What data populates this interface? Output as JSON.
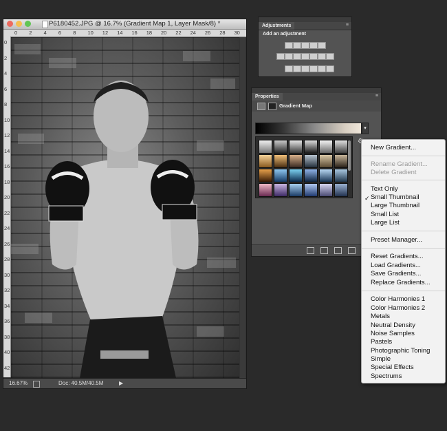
{
  "document": {
    "title": "P6180452.JPG @ 16.7% (Gradient Map 1, Layer Mask/8) *",
    "ruler_h": [
      "0",
      "2",
      "4",
      "6",
      "8",
      "10",
      "12",
      "14",
      "16",
      "18",
      "20",
      "22",
      "24",
      "26",
      "28",
      "30"
    ],
    "ruler_v": [
      "0",
      "2",
      "4",
      "6",
      "8",
      "10",
      "12",
      "14",
      "16",
      "18",
      "20",
      "22",
      "24",
      "26",
      "28",
      "30",
      "32",
      "34",
      "36",
      "38",
      "40",
      "42"
    ],
    "zoom": "16.67%",
    "doc_size": "Doc: 40.5M/40.5M",
    "status_arrow": "▶",
    "file_icon": "document-icon"
  },
  "adjustments": {
    "tab": "Adjustments",
    "subtitle": "Add an adjustment",
    "menu_glyph": "≡"
  },
  "properties": {
    "tab": "Properties",
    "title": "Gradient Map",
    "menu_glyph": "≡",
    "dropdown_glyph": "▾",
    "gear_glyph": "⚙"
  },
  "menu": {
    "items": [
      {
        "label": "New Gradient...",
        "disabled": false
      },
      {
        "label": "Rename Gradient...",
        "disabled": true
      },
      {
        "label": "Delete Gradient",
        "disabled": true
      },
      {
        "label": "Text Only",
        "disabled": false
      },
      {
        "label": "Small Thumbnail",
        "disabled": false,
        "checked": true
      },
      {
        "label": "Large Thumbnail",
        "disabled": false
      },
      {
        "label": "Small List",
        "disabled": false
      },
      {
        "label": "Large List",
        "disabled": false
      },
      {
        "label": "Preset Manager...",
        "disabled": false
      },
      {
        "label": "Reset Gradients...",
        "disabled": false
      },
      {
        "label": "Load Gradients...",
        "disabled": false
      },
      {
        "label": "Save Gradients...",
        "disabled": false
      },
      {
        "label": "Replace Gradients...",
        "disabled": false
      },
      {
        "label": "Color Harmonies 1",
        "disabled": false
      },
      {
        "label": "Color Harmonies 2",
        "disabled": false
      },
      {
        "label": "Metals",
        "disabled": false
      },
      {
        "label": "Neutral Density",
        "disabled": false
      },
      {
        "label": "Noise Samples",
        "disabled": false
      },
      {
        "label": "Pastels",
        "disabled": false
      },
      {
        "label": "Photographic Toning",
        "disabled": false
      },
      {
        "label": "Simple",
        "disabled": false
      },
      {
        "label": "Special Effects",
        "disabled": false
      },
      {
        "label": "Spectrums",
        "disabled": false
      }
    ],
    "check_glyph": "✓"
  },
  "colors": {
    "app_bg": "#2a2a2a",
    "panel_bg": "#535353",
    "menu_bg": "#f2f2f2",
    "swatches": [
      [
        "#f0f0f0",
        "#7a7a7a"
      ],
      [
        "#c9c9c9",
        "#2a2a2a"
      ],
      [
        "#e6e6e6",
        "#3b3b3b"
      ],
      [
        "#dcdcdc",
        "#1e1e1e"
      ],
      [
        "#f4f4f4",
        "#6a6a6a"
      ],
      [
        "#e0e0e0",
        "#444"
      ],
      [
        "#f7d49a",
        "#8a5a1f"
      ],
      [
        "#f2c07a",
        "#4b2f12"
      ],
      [
        "#d8b08a",
        "#3b2a22"
      ],
      [
        "#b7c3cf",
        "#24303c"
      ],
      [
        "#d9c7a6",
        "#5a4a33"
      ],
      [
        "#c7b59a",
        "#2b2218"
      ],
      [
        "#e6a04a",
        "#3a1c06"
      ],
      [
        "#8ec7f0",
        "#163b66"
      ],
      [
        "#7bd0f0",
        "#0c2b4d"
      ],
      [
        "#8fb3e8",
        "#0f2440"
      ],
      [
        "#b7d7f2",
        "#1a3656"
      ],
      [
        "#a9c8e0",
        "#22384e"
      ],
      [
        "#f0b9c6",
        "#6a2a52"
      ],
      [
        "#c8b5e0",
        "#3e2a66"
      ],
      [
        "#a8d0f0",
        "#1b3c66"
      ],
      [
        "#b0c8f0",
        "#203a70"
      ],
      [
        "#d6d6f0",
        "#4a4a72"
      ],
      [
        "#9ab0d0",
        "#223250"
      ]
    ]
  }
}
